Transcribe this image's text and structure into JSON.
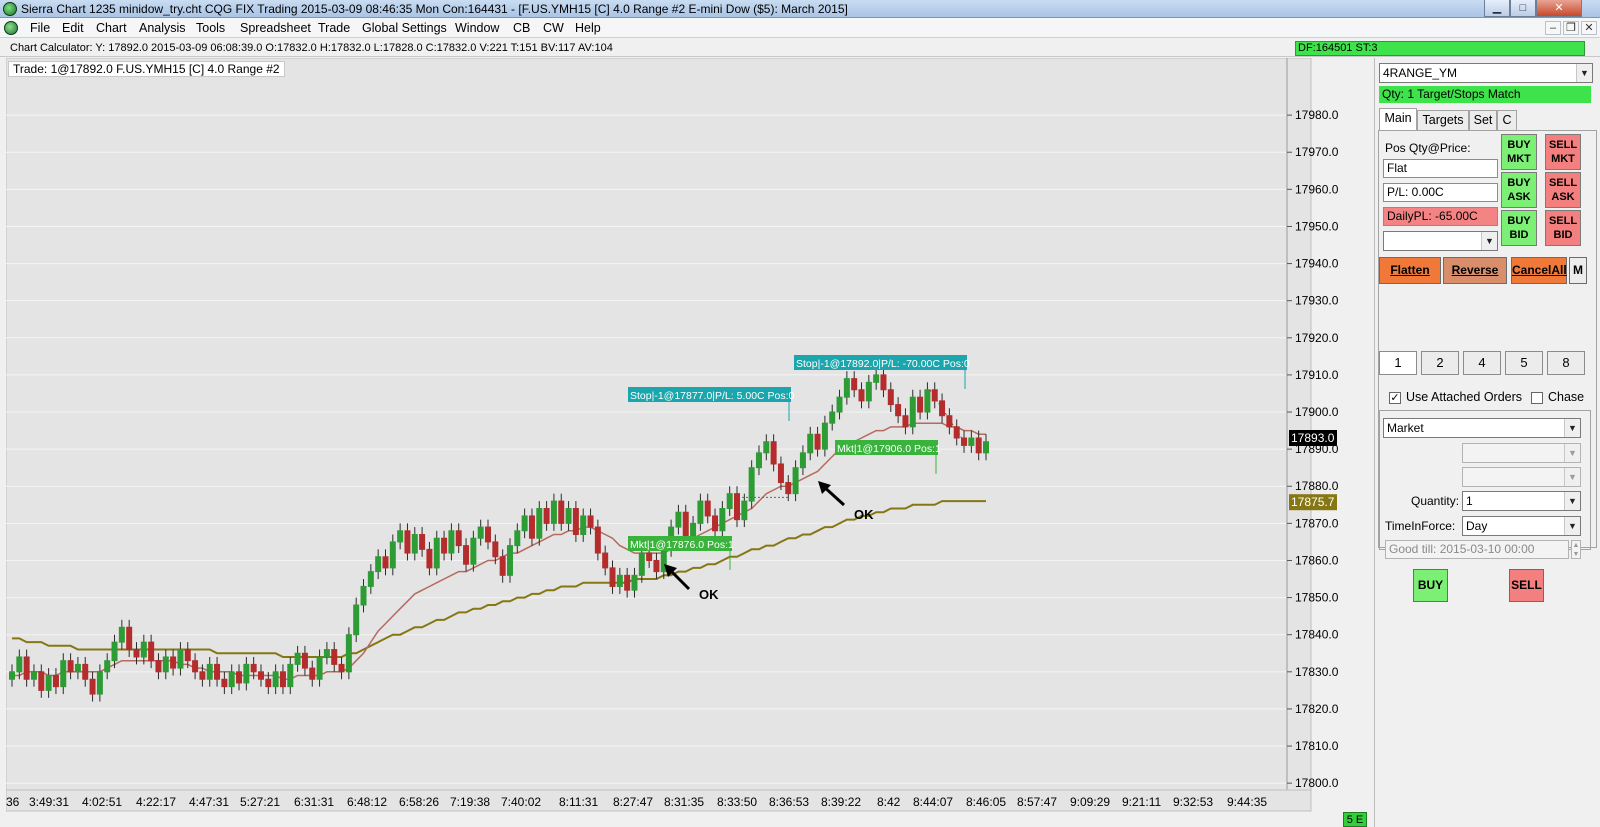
{
  "window": {
    "title": "Sierra Chart 1235 minidow_try.cht  CQG FIX Trading 2015-03-09  08:46:35 Mon  Con:164431 - [F.US.YMH15 [C]  4.0 Range  #2  E-mini Dow ($5): March 2015]",
    "minimize": "▁",
    "maximize": "□",
    "close": "✕"
  },
  "menu": {
    "items": [
      "File",
      "Edit",
      "Chart",
      "Analysis",
      "Tools",
      "Spreadsheet",
      "Trade",
      "Global Settings",
      "Window",
      "CB",
      "CW",
      "Help"
    ],
    "mdi_minimize": "–",
    "mdi_restore": "❐",
    "mdi_close": "✕"
  },
  "calc": {
    "text": "Chart Calculator: Y: 17892.0  2015-03-09  06:08:39.0  O:17832.0  H:17832.0  L:17828.0  C:17832.0  V:221  T:151  BV:117  AV:104",
    "status": "DF:164501  ST:3"
  },
  "chart_header": "Trade: 1@17892.0  F.US.YMH15 [C]  4.0 Range  #2",
  "chart_data": {
    "type": "candlestick",
    "y_ticks": [
      17980,
      17970,
      17960,
      17950,
      17940,
      17930,
      17920,
      17910,
      17900,
      17890,
      17880,
      17870,
      17860,
      17850,
      17840,
      17830,
      17820,
      17810,
      17800
    ],
    "y_tick_labels": [
      "17980.0",
      "17970.0",
      "17960.0",
      "17950.0",
      "17940.0",
      "17930.0",
      "17920.0",
      "17910.0",
      "17900.0",
      "17890.0",
      "17880.0",
      "17870.0",
      "17860.0",
      "17850.0",
      "17840.0",
      "17830.0",
      "17820.0",
      "17810.0",
      "17800.0"
    ],
    "ylim": [
      17796,
      17990
    ],
    "x_labels": [
      "36",
      "3:49:31",
      "4:02:51",
      "4:22:17",
      "4:47:31",
      "5:27:21",
      "6:31:31",
      "6:48:12",
      "6:58:26",
      "7:19:38",
      "7:40:02",
      "8:11:31",
      "8:27:47",
      "8:31:35",
      "8:33:50",
      "8:36:53",
      "8:39:22",
      "8:42",
      "8:44:07",
      "8:46:05",
      "8:57:47",
      "9:09:29",
      "9:21:11",
      "9:32:53",
      "9:44:35"
    ],
    "closes": [
      17830,
      17834,
      17828,
      17830,
      17825,
      17829,
      17826,
      17833,
      17830,
      17832,
      17828,
      17824,
      17830,
      17833,
      17838,
      17842,
      17836,
      17834,
      17838,
      17833,
      17830,
      17834,
      17831,
      17836,
      17833,
      17830,
      17828,
      17832,
      17828,
      17826,
      17830,
      17827,
      17832,
      17830,
      17828,
      17826,
      17830,
      17826,
      17832,
      17835,
      17831,
      17828,
      17834,
      17836,
      17832,
      17830,
      17840,
      17848,
      17853,
      17857,
      17861,
      17858,
      17865,
      17868,
      17862,
      17867,
      17863,
      17858,
      17866,
      17862,
      17868,
      17864,
      17859,
      17866,
      17869,
      17865,
      17861,
      17856,
      17864,
      17868,
      17872,
      17866,
      17874,
      17870,
      17876,
      17870,
      17874,
      17867,
      17872,
      17869,
      17862,
      17858,
      17853,
      17856,
      17852,
      17856,
      17862,
      17860,
      17857,
      17863,
      17869,
      17873,
      17866,
      17870,
      17876,
      17872,
      17868,
      17874,
      17878,
      17871,
      17876,
      17885,
      17889,
      17892,
      17886,
      17881,
      17878,
      17885,
      17889,
      17894,
      17890,
      17897,
      17900,
      17904,
      17909,
      17906,
      17903,
      17908,
      17910,
      17906,
      17902,
      17899,
      17896,
      17904,
      17900,
      17906,
      17903,
      17899,
      17896,
      17893,
      17891,
      17893,
      17889,
      17892
    ],
    "sma_fast": [
      17829,
      17829,
      17830,
      17830,
      17830,
      17829,
      17829,
      17830,
      17830,
      17830,
      17830,
      17830,
      17830,
      17831,
      17832,
      17833,
      17833,
      17833,
      17833,
      17833,
      17833,
      17833,
      17833,
      17832,
      17832,
      17831,
      17831,
      17830,
      17830,
      17830,
      17830,
      17829,
      17829,
      17829,
      17829,
      17829,
      17829,
      17828,
      17828,
      17829,
      17829,
      17829,
      17829,
      17830,
      17830,
      17830,
      17831,
      17833,
      17835,
      17838,
      17841,
      17843,
      17845,
      17847,
      17849,
      17851,
      17852,
      17853,
      17854,
      17855,
      17856,
      17857,
      17857,
      17858,
      17859,
      17860,
      17860,
      17861,
      17862,
      17862,
      17863,
      17864,
      17865,
      17866,
      17867,
      17867,
      17868,
      17868,
      17869,
      17869,
      17868,
      17867,
      17866,
      17864,
      17863,
      17862,
      17862,
      17862,
      17862,
      17862,
      17863,
      17864,
      17865,
      17866,
      17867,
      17868,
      17869,
      17870,
      17871,
      17872,
      17873,
      17874,
      17876,
      17878,
      17879,
      17880,
      17880,
      17881,
      17882,
      17883,
      17884,
      17886,
      17888,
      17890,
      17891,
      17892,
      17893,
      17894,
      17895,
      17895,
      17896,
      17896,
      17896,
      17897,
      17897,
      17897,
      17897,
      17897,
      17896,
      17896,
      17895,
      17895,
      17894,
      17894
    ],
    "sma_slow": [
      17839,
      17839,
      17838,
      17838,
      17838,
      17837,
      17837,
      17837,
      17837,
      17836,
      17836,
      17836,
      17836,
      17836,
      17836,
      17836,
      17836,
      17836,
      17836,
      17836,
      17836,
      17836,
      17836,
      17836,
      17836,
      17836,
      17836,
      17836,
      17835,
      17835,
      17835,
      17835,
      17835,
      17835,
      17835,
      17835,
      17835,
      17834,
      17834,
      17834,
      17834,
      17834,
      17834,
      17834,
      17834,
      17834,
      17835,
      17835,
      17836,
      17837,
      17838,
      17839,
      17840,
      17840,
      17841,
      17842,
      17842,
      17843,
      17844,
      17844,
      17845,
      17846,
      17846,
      17847,
      17847,
      17848,
      17848,
      17849,
      17849,
      17850,
      17850,
      17851,
      17851,
      17852,
      17852,
      17853,
      17853,
      17853,
      17854,
      17854,
      17854,
      17854,
      17854,
      17854,
      17854,
      17855,
      17855,
      17855,
      17855,
      17856,
      17856,
      17857,
      17857,
      17858,
      17858,
      17859,
      17859,
      17860,
      17861,
      17861,
      17862,
      17863,
      17863,
      17864,
      17864,
      17865,
      17866,
      17866,
      17867,
      17867,
      17868,
      17869,
      17869,
      17870,
      17871,
      17871,
      17872,
      17872,
      17873,
      17873,
      17874,
      17874,
      17874,
      17875,
      17875,
      17875,
      17875,
      17876,
      17876,
      17876,
      17876,
      17876,
      17876,
      17876
    ],
    "last_price_label": "17893.0",
    "slow_ma_label": "17875.7",
    "annotations": [
      {
        "text": "Stop|-1@17877.0|P/L: 5.00C Pos:0",
        "color": "#1aa6ac",
        "price": 17877
      },
      {
        "text": "Stop|-1@17892.0|P/L: -70.00C Pos:0",
        "color": "#1aa6ac",
        "price": 17892
      },
      {
        "text": "Mkt|1@17876.0 Pos:1",
        "color": "#39b33b",
        "price": 17876
      },
      {
        "text": "Mkt|1@17906.0 Pos:1",
        "color": "#39b33b",
        "price": 17906
      }
    ],
    "notes": [
      "OK",
      "OK"
    ],
    "colors": {
      "up": "#2e9c35",
      "down": "#b52c2c",
      "sma_fast": "#b56a5e",
      "sma_slow": "#867714",
      "grid": "#f4f4f4",
      "background": "#e4e4e4"
    }
  },
  "status_badge": "5 E",
  "panel": {
    "symbol": "4RANGE_YM",
    "status": "Qty: 1 Target/Stops Match",
    "tabs": [
      "Main",
      "Targets",
      "Set",
      "C"
    ],
    "pos_label": "Pos Qty@Price:",
    "pos_value": "Flat",
    "pl_value": "P/L: 0.00C",
    "daily_pl": "DailyPL: -65.00C",
    "buttons": {
      "buy_mkt": [
        "BUY",
        "MKT"
      ],
      "sell_mkt": [
        "SELL",
        "MKT"
      ],
      "buy_ask": [
        "BUY",
        "ASK"
      ],
      "sell_ask": [
        "SELL",
        "ASK"
      ],
      "buy_bid": [
        "BUY",
        "BID"
      ],
      "sell_bid": [
        "SELL",
        "BID"
      ]
    },
    "flatten": "Flatten",
    "reverse": "Reverse",
    "cancel_all": "CancelAll",
    "m_button": "M",
    "quantities": [
      "1",
      "2",
      "4",
      "5",
      "8"
    ],
    "use_attached": "Use Attached Orders",
    "chase": "Chase",
    "order_type": "Market",
    "quantity_label": "Quantity:",
    "quantity_value": "1",
    "tif_label": "TimeInForce:",
    "tif_value": "Day",
    "good_till": "Good till: 2015-03-10 00:00",
    "buy": "BUY",
    "sell": "SELL"
  }
}
